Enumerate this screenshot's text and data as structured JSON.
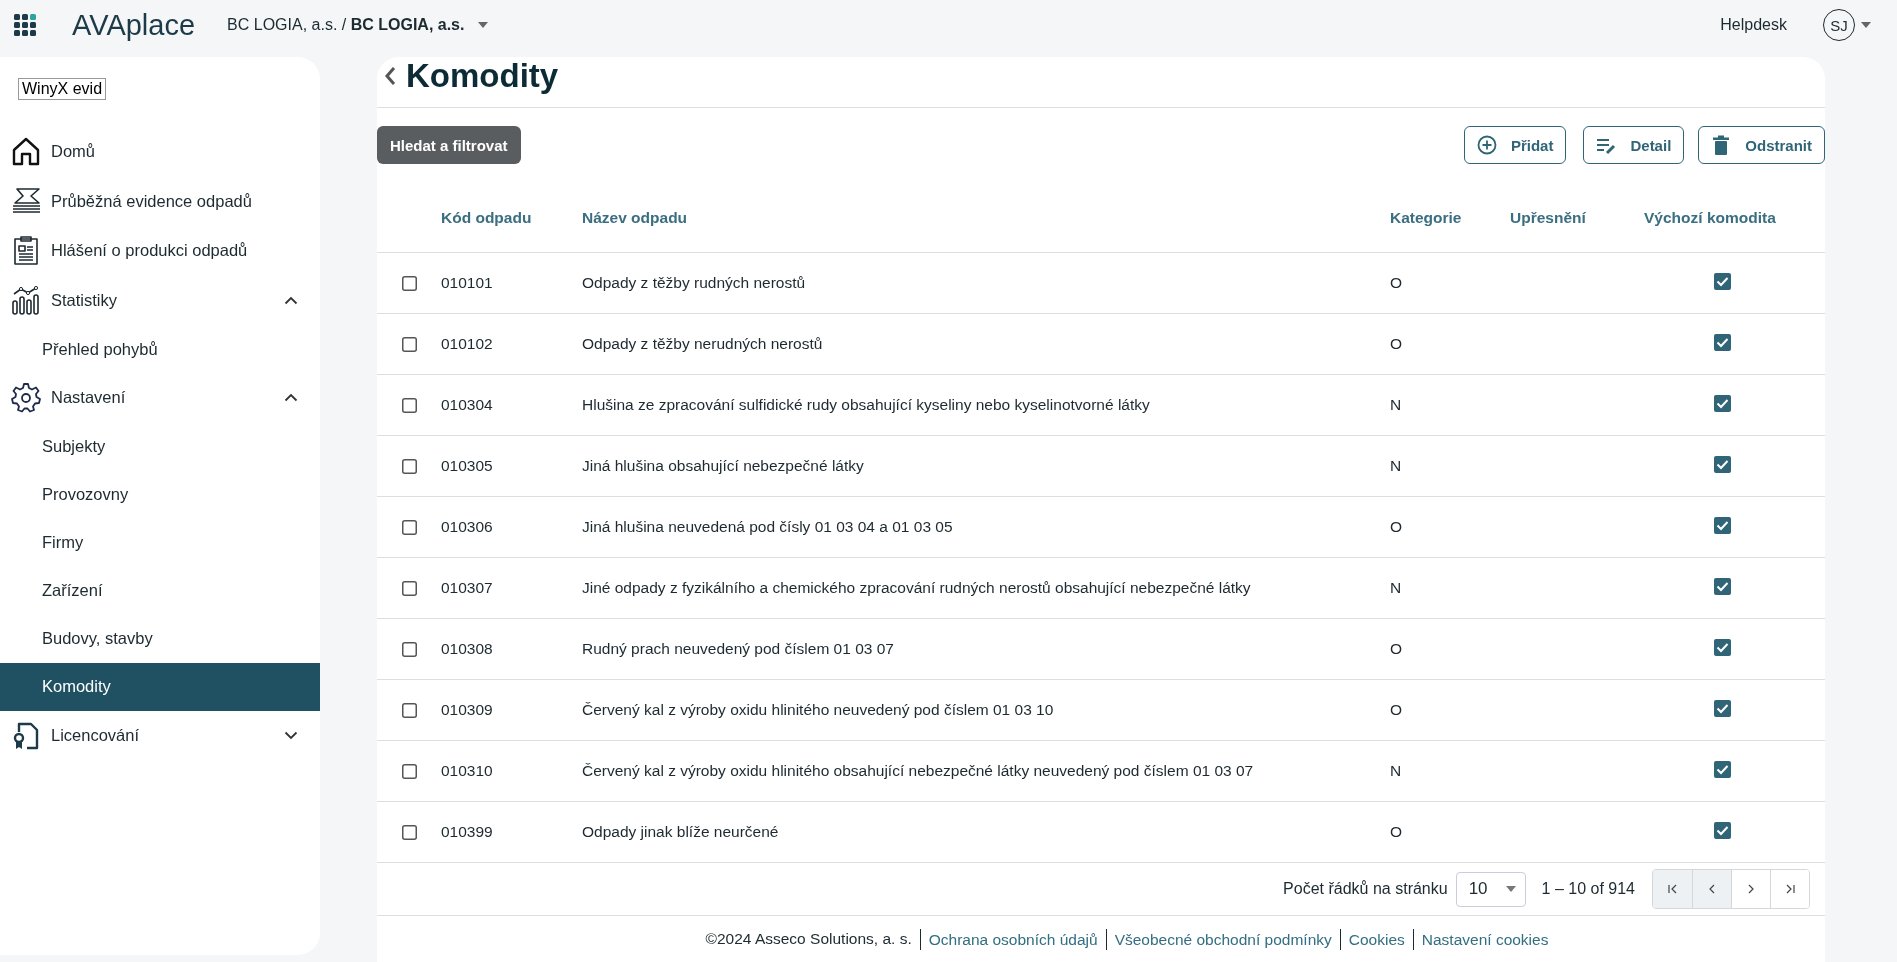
{
  "header": {
    "logo": "**AVA**place",
    "company": "BC LOGIA, a.s. / **BC LOGIA, a.s.**",
    "helpdesk": "Helpdesk",
    "avatar": "SJ"
  },
  "sidebar": {
    "app_label": "WinyX evid",
    "items": [
      {
        "label": "Domů",
        "kind": "house",
        "selected": false
      },
      {
        "label": "Průběžná evidence odpadů",
        "kind": "papers",
        "selected": false
      },
      {
        "label": "Hlášení o produkci odpadů",
        "kind": "clipboard",
        "selected": false
      },
      {
        "label": "Statistiky",
        "kind": "stats",
        "selected": false,
        "expanded": true,
        "children": [
          {
            "label": "Přehled pohybů",
            "selected": false
          }
        ]
      },
      {
        "label": "Nastavení",
        "kind": "gear",
        "selected": false,
        "expanded": true,
        "children": [
          {
            "label": "Subjekty",
            "selected": false
          },
          {
            "label": "Provozovny",
            "selected": false
          },
          {
            "label": "Firmy",
            "selected": false
          },
          {
            "label": "Zařízení",
            "selected": false
          },
          {
            "label": "Budovy, stavby",
            "selected": false
          },
          {
            "label": "Komodity",
            "selected": true
          }
        ]
      },
      {
        "label": "Licencování",
        "kind": "license",
        "selected": false,
        "expanded": false
      }
    ]
  },
  "page": {
    "title": "Komodity"
  },
  "toolbar": {
    "filter_button": "Hledat a filtrovat",
    "actions": [
      {
        "label": "Přidat",
        "kind": "add"
      },
      {
        "label": "Detail",
        "kind": "detail"
      },
      {
        "label": "Odstranit",
        "kind": "delete"
      }
    ]
  },
  "table": {
    "columns": [
      "Kód odpadu",
      "Název odpadu",
      "Kategorie",
      "Upřesnění",
      "Výchozí komodita"
    ],
    "rows": [
      {
        "selected": false,
        "code": "010101",
        "name": "Odpady z těžby rudných nerostů",
        "category": "O",
        "default_commodity": true
      },
      {
        "selected": false,
        "code": "010102",
        "name": "Odpady z těžby nerudných nerostů",
        "category": "O",
        "default_commodity": true
      },
      {
        "selected": false,
        "code": "010304",
        "name": "Hlušina ze zpracování sulfidické rudy obsahující kyseliny nebo kyselinotvorné látky",
        "category": "N",
        "default_commodity": true
      },
      {
        "selected": false,
        "code": "010305",
        "name": "Jiná hlušina obsahující nebezpečné látky",
        "category": "N",
        "default_commodity": true
      },
      {
        "selected": false,
        "code": "010306",
        "name": "Jiná hlušina neuvedená pod čísly 01 03 04 a 01 03 05",
        "category": "O",
        "default_commodity": true
      },
      {
        "selected": false,
        "code": "010307",
        "name": "Jiné odpady z fyzikálního a chemického zpracování rudných nerostů obsahující nebezpečné látky",
        "category": "N",
        "default_commodity": true
      },
      {
        "selected": false,
        "code": "010308",
        "name": "Rudný prach neuvedený pod číslem 01 03 07",
        "category": "O",
        "default_commodity": true
      },
      {
        "selected": false,
        "code": "010309",
        "name": "Červený kal z výroby oxidu hlinitého neuvedený pod číslem 01 03 10",
        "category": "O",
        "default_commodity": true
      },
      {
        "selected": false,
        "code": "010310",
        "name": "Červený kal z výroby oxidu hlinitého obsahující nebezpečné látky neuvedený pod číslem 01 03 07",
        "category": "N",
        "default_commodity": true
      },
      {
        "selected": false,
        "code": "010399",
        "name": "Odpady jinak blíže neurčené",
        "category": "O",
        "default_commodity": true
      }
    ]
  },
  "pagination": {
    "rows_label": "Počet řádků na stránku",
    "page_size": "10",
    "range": "1 – 10 of 914",
    "buttons": [
      {
        "kind": "first",
        "disabled": true
      },
      {
        "kind": "prev",
        "disabled": true
      },
      {
        "kind": "next",
        "disabled": false
      },
      {
        "kind": "last",
        "disabled": false
      }
    ]
  },
  "footer": {
    "copyright": "©2024 Asseco Solutions, a. s.",
    "links": [
      "Ochrana osobních údajů",
      "Všeobecné obchodní podmínky",
      "Cookies",
      "Nastavení cookies"
    ]
  }
}
